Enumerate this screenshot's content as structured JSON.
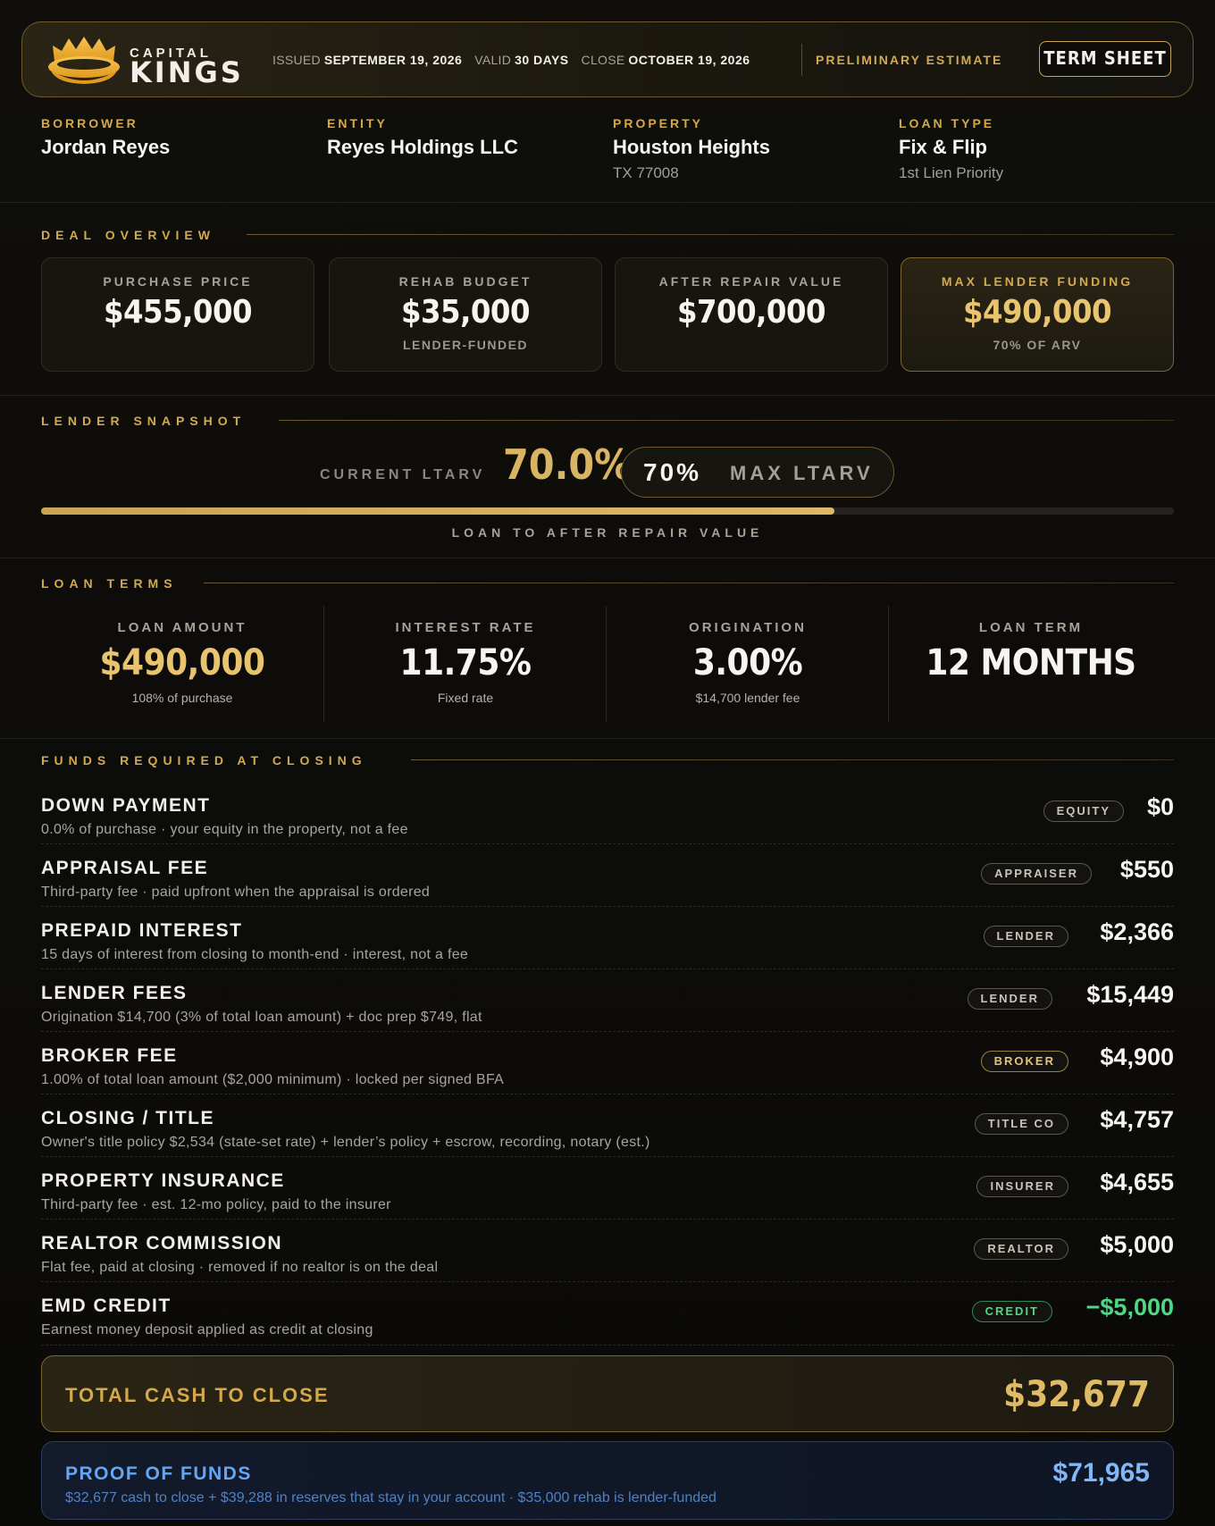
{
  "colors": {
    "gold": "#d4a94e",
    "gold_value": "#e8c46e",
    "green": "#4fd884",
    "blue": "#64a6f2",
    "background": "#0b0a08"
  },
  "header": {
    "logo_top": "CAPITAL",
    "logo_bottom": "KINGS",
    "logo_icon": "crown-icon",
    "issued_label": "ISSUED",
    "issued_value": "SEPTEMBER 19, 2026",
    "valid_label": "VALID",
    "valid_value": "30 DAYS",
    "close_label": "CLOSE",
    "close_value": "OCTOBER 19, 2026",
    "status": "PRELIMINARY ESTIMATE",
    "doc_button": "TERM SHEET"
  },
  "parties": [
    {
      "label": "BORROWER",
      "value": "Jordan Reyes",
      "sub": ""
    },
    {
      "label": "ENTITY",
      "value": "Reyes Holdings LLC",
      "sub": ""
    },
    {
      "label": "PROPERTY",
      "value": "Houston Heights",
      "sub": "TX 77008"
    },
    {
      "label": "LOAN TYPE",
      "value": "Fix & Flip",
      "sub": "1st Lien Priority"
    }
  ],
  "deal_overview": {
    "title": "DEAL OVERVIEW",
    "cards": [
      {
        "label": "PURCHASE PRICE",
        "value": "$455,000",
        "sub": ""
      },
      {
        "label": "REHAB BUDGET",
        "value": "$35,000",
        "sub": "LENDER-FUNDED"
      },
      {
        "label": "AFTER REPAIR VALUE",
        "value": "$700,000",
        "sub": ""
      },
      {
        "label": "MAX LENDER FUNDING",
        "value": "$490,000",
        "sub": "70% OF ARV"
      }
    ]
  },
  "lender_snapshot": {
    "title": "LENDER SNAPSHOT",
    "current_label": "CURRENT LTARV",
    "current_value": "70.0%",
    "max_pct": "70%",
    "max_label": "MAX LTARV",
    "bar_fraction": 0.7,
    "caption": "LOAN TO AFTER REPAIR VALUE"
  },
  "loan_terms": {
    "title": "LOAN TERMS",
    "items": [
      {
        "label": "LOAN AMOUNT",
        "value": "$490,000",
        "sub": "108% of purchase"
      },
      {
        "label": "INTEREST RATE",
        "value": "11.75%",
        "sub": "Fixed rate"
      },
      {
        "label": "ORIGINATION",
        "value": "3.00%",
        "sub": "$14,700 lender fee"
      },
      {
        "label": "LOAN TERM",
        "value": "12 MONTHS",
        "sub": ""
      }
    ]
  },
  "funds": {
    "title": "FUNDS REQUIRED AT CLOSING",
    "rows": [
      {
        "title": "DOWN PAYMENT",
        "desc": "0.0% of purchase · your equity in the property, not a fee",
        "tag": "EQUITY",
        "amount": "$0"
      },
      {
        "title": "APPRAISAL FEE",
        "desc": "Third-party fee · paid upfront when the appraisal is ordered",
        "tag": "APPRAISER",
        "amount": "$550"
      },
      {
        "title": "PREPAID INTEREST",
        "desc": "15 days of interest from closing to month-end · interest, not a fee",
        "tag": "LENDER",
        "amount": "$2,366"
      },
      {
        "title": "LENDER FEES",
        "desc": "Origination $14,700 (3% of total loan amount) + doc prep $749, flat",
        "tag": "LENDER",
        "amount": "$15,449"
      },
      {
        "title": "BROKER FEE",
        "desc": "1.00% of total loan amount ($2,000 minimum) · locked per signed BFA",
        "tag": "BROKER",
        "amount": "$4,900"
      },
      {
        "title": "CLOSING / TITLE",
        "desc": "Owner's title policy $2,534 (state-set rate) + lender’s policy + escrow, recording, notary (est.)",
        "tag": "TITLE CO",
        "amount": "$4,757"
      },
      {
        "title": "PROPERTY INSURANCE",
        "desc": "Third-party fee · est. 12-mo policy, paid to the insurer",
        "tag": "INSURER",
        "amount": "$4,655"
      },
      {
        "title": "REALTOR COMMISSION",
        "desc": "Flat fee, paid at closing · removed if no realtor is on the deal",
        "tag": "REALTOR",
        "amount": "$5,000"
      },
      {
        "title": "EMD CREDIT",
        "desc": "Earnest money deposit applied as credit at closing",
        "tag": "CREDIT",
        "amount": "−$5,000"
      }
    ]
  },
  "total": {
    "label": "TOTAL CASH TO CLOSE",
    "value": "$32,677"
  },
  "proof_of_funds": {
    "label": "PROOF OF FUNDS",
    "desc": "$32,677 cash to close + $39,288 in reserves that stay in your account · $35,000 rehab is lender-funded",
    "value": "$71,965"
  }
}
